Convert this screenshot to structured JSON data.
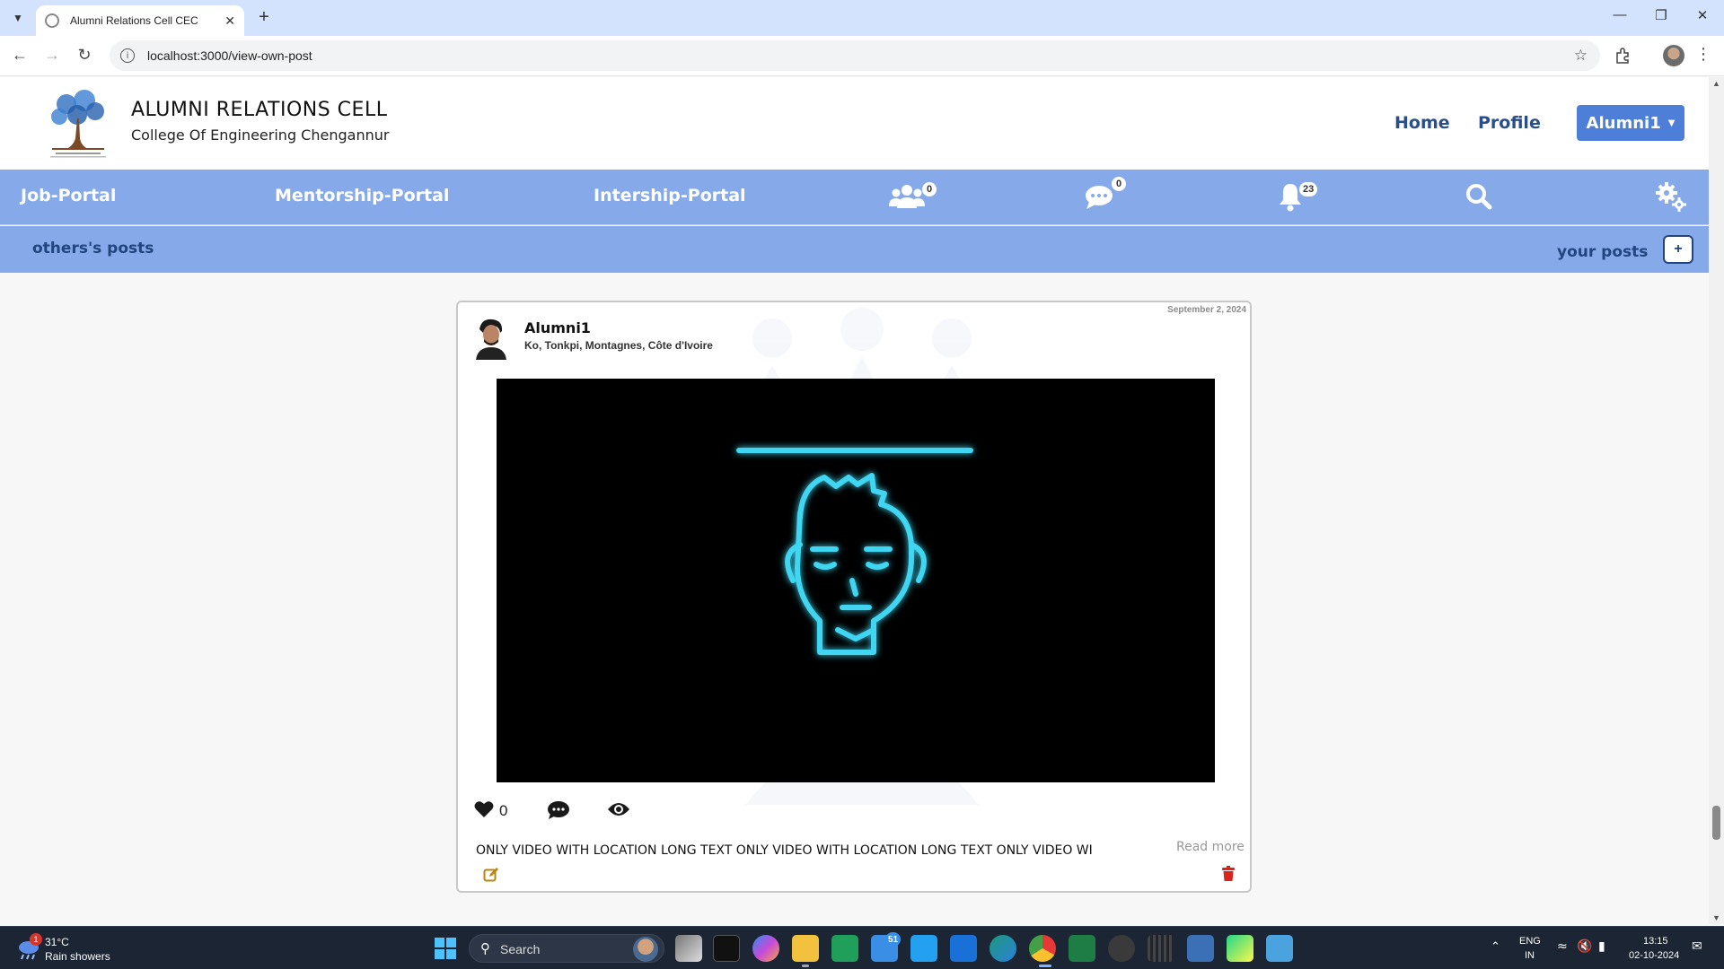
{
  "browser": {
    "tab_title": "Alumni Relations Cell CEC",
    "url": "localhost:3000/view-own-post"
  },
  "header": {
    "title": "ALUMNI RELATIONS CELL",
    "subtitle": "College Of Engineering Chengannur",
    "links": [
      "Home",
      "Profile"
    ],
    "user_menu_label": "Alumni1"
  },
  "portal_nav": {
    "links": [
      "Job-Portal",
      "Mentorship-Portal",
      "Intership-Portal"
    ],
    "badges": {
      "connections": "0",
      "messages": "0",
      "notifications": "23"
    }
  },
  "posts_bar": {
    "left_label": "others's posts",
    "right_label": "your posts",
    "add_label": "+"
  },
  "post": {
    "date": "September 2, 2024",
    "author": "Alumni1",
    "location": "Ko, Tonkpi, Montagnes, Côte d'Ivoire",
    "likes": "0",
    "caption": "ONLY VIDEO WITH LOCATION LONG TEXT ONLY VIDEO WITH LOCATION LONG TEXT ONLY VIDEO WI",
    "read_more": "Read more"
  },
  "taskbar": {
    "temperature": "31°C",
    "weather": "Rain showers",
    "weather_badge": "1",
    "search_label": "Search",
    "mail_badge": "51",
    "lang_line1": "ENG",
    "lang_line2": "IN",
    "time": "13:15",
    "date": "02-10-2024"
  },
  "colors": {
    "nav_blue": "#86a9ea",
    "button_blue": "#4d7fd8",
    "link_blue": "#2a4e8a",
    "video_accent": "#3fd6f2",
    "delete_red": "#d9231c",
    "edit_gold": "#b8860b"
  }
}
